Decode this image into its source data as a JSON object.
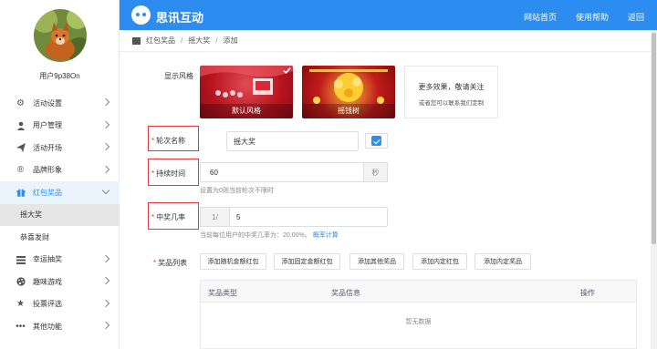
{
  "sidebar": {
    "username": "用户9p38On",
    "menu": [
      {
        "label": "活动设置",
        "icon": "gear-icon"
      },
      {
        "label": "用户管理",
        "icon": "user-icon"
      },
      {
        "label": "活动开场",
        "icon": "paper-plane-icon"
      },
      {
        "label": "品牌形象",
        "icon": "registered-icon"
      },
      {
        "label": "红包奖品",
        "icon": "gift-icon"
      },
      {
        "label": "幸运抽奖",
        "icon": "list-icon"
      },
      {
        "label": "趣味游戏",
        "icon": "palette-icon"
      },
      {
        "label": "投票评选",
        "icon": "star-icon"
      },
      {
        "label": "其他功能",
        "icon": "ellipsis-icon"
      }
    ],
    "submenu": [
      {
        "label": "摇大奖"
      },
      {
        "label": "恭喜发财"
      }
    ]
  },
  "header": {
    "logo_text": "思讯互动",
    "links": [
      "网站首页",
      "使用帮助",
      "返回"
    ]
  },
  "breadcrumb": [
    "红包奖品",
    "摇大奖",
    "添加"
  ],
  "form": {
    "style_label": "显示风格",
    "styles": [
      {
        "label": "默认风格",
        "selected": true
      },
      {
        "label": "摇钱树",
        "selected": false
      }
    ],
    "more": {
      "title": "更多效果，敬请关注",
      "subtitle": "或者您可以联系我们定制"
    },
    "round_name": {
      "label": "轮次名称",
      "value": "摇大奖",
      "checked": true
    },
    "duration": {
      "label": "持续时间",
      "value": "60",
      "unit": "秒",
      "hint": "设置为0则当前轮次不限时"
    },
    "win_rate": {
      "label": "中奖几率",
      "prefix": "1/",
      "value": "5",
      "hint": "当前每位用户的中奖几率为：20.00%。",
      "hint_link": "概率计算"
    },
    "prize_list": {
      "label": "奖品列表",
      "buttons": [
        "添加随机金额红包",
        "添加固定金额红包",
        "添加其他奖品",
        "添加内定红包",
        "添加内定奖品"
      ],
      "columns": [
        "奖品类型",
        "奖品信息",
        "操作"
      ],
      "empty_text": "暂无数据"
    }
  },
  "colors": {
    "primary": "#2d8cf0",
    "required": "#e4393c",
    "highlight_box": "#e4393c"
  }
}
